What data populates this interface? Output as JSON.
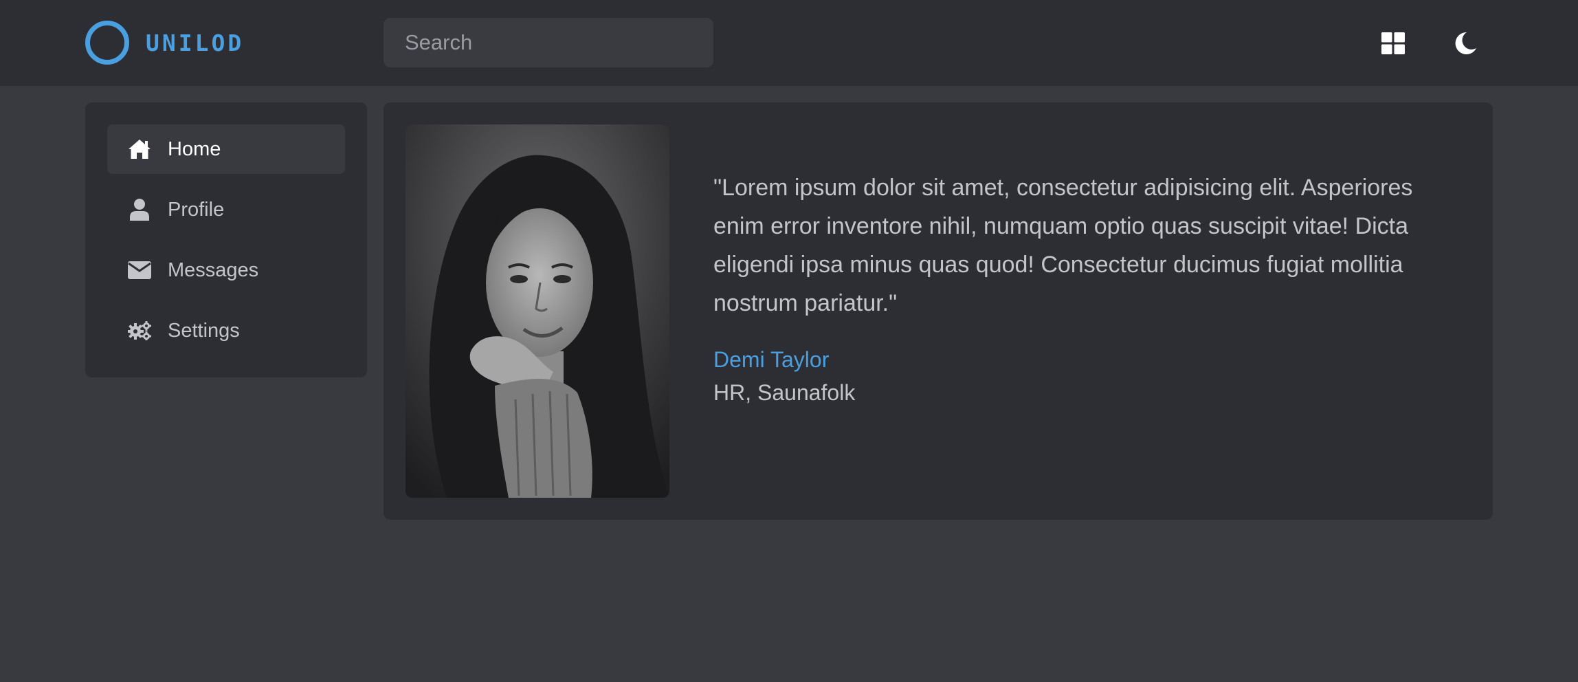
{
  "header": {
    "logo_text": "UNILOD",
    "search_placeholder": "Search",
    "grid_icon": "grid-icon",
    "theme_icon": "moon-icon"
  },
  "sidebar": {
    "items": [
      {
        "label": "Home",
        "icon": "home-icon",
        "active": true
      },
      {
        "label": "Profile",
        "icon": "user-icon",
        "active": false
      },
      {
        "label": "Messages",
        "icon": "envelope-icon",
        "active": false
      },
      {
        "label": "Settings",
        "icon": "gears-icon",
        "active": false
      }
    ]
  },
  "testimonial": {
    "quote": "\"Lorem ipsum dolor sit amet, consectetur adipisicing elit. Asperiores enim error inventore nihil, numquam optio quas suscipit vitae! Dicta eligendi ipsa minus quas quod! Consectetur ducimus fugiat mollitia nostrum pariatur.\"",
    "author": "Demi Taylor",
    "role": "HR, Saunafolk"
  },
  "colors": {
    "accent": "#4a9fe0",
    "background": "#393a40",
    "panel": "#2d2e33"
  }
}
